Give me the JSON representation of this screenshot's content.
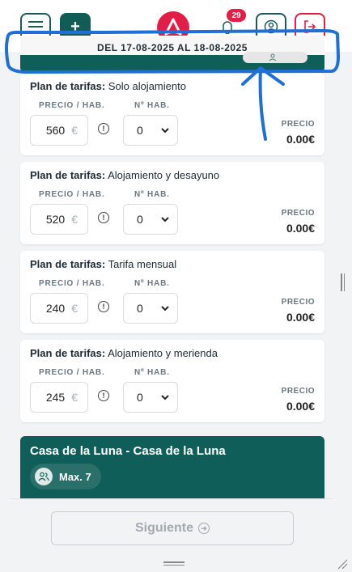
{
  "topbar": {
    "notification_count": "29"
  },
  "date_banner": {
    "text": "DEL 17-08-2025 AL 18-08-2025"
  },
  "labels": {
    "plan_prefix": "Plan de tarifas:",
    "price_col": "PRECIO / HAB.",
    "qty_col": "Nº HAB.",
    "total_col": "PRECIO",
    "currency": "€"
  },
  "rates": [
    {
      "plan": "Solo alojamiento",
      "price": "560",
      "qty": "0",
      "total": "0.00€"
    },
    {
      "plan": "Alojamiento y desayuno",
      "price": "520",
      "qty": "0",
      "total": "0.00€"
    },
    {
      "plan": "Tarifa mensual",
      "price": "240",
      "qty": "0",
      "total": "0.00€"
    },
    {
      "plan": "Alojamiento y merienda",
      "price": "245",
      "qty": "0",
      "total": "0.00€"
    }
  ],
  "property": {
    "title": "Casa de la Luna - Casa de la Luna",
    "capacity": "Max. 7"
  },
  "footer": {
    "next_label": "Siguiente"
  },
  "colors": {
    "primary": "#0f5e59",
    "accent": "#e11d48",
    "annotation": "#1f6fd6"
  }
}
